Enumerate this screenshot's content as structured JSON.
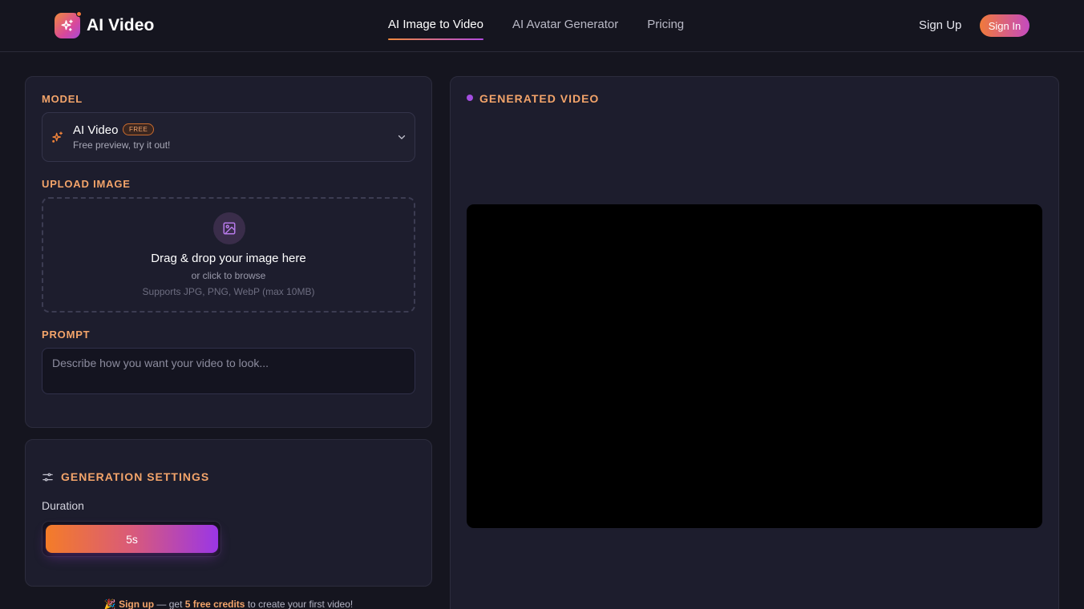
{
  "header": {
    "brand": "AI Video",
    "nav": [
      {
        "label": "AI Image to Video",
        "active": true
      },
      {
        "label": "AI Avatar Generator",
        "active": false
      },
      {
        "label": "Pricing",
        "active": false
      }
    ],
    "sign_up": "Sign Up",
    "sign_in": "Sign In"
  },
  "form": {
    "model_label": "MODEL",
    "model": {
      "name": "AI Video",
      "badge": "FREE",
      "description": "Free preview, try it out!",
      "icon": "sparkle-icon"
    },
    "upload_label": "UPLOAD IMAGE",
    "upload": {
      "title": "Drag & drop your image here",
      "subtitle": "or click to browse",
      "hint": "Supports JPG, PNG, WebP (max 10MB)",
      "icon": "image-icon"
    },
    "prompt_label": "PROMPT",
    "prompt_placeholder": "Describe how you want your video to look...",
    "prompt_value": ""
  },
  "settings": {
    "title": "GENERATION SETTINGS",
    "duration_label": "Duration",
    "duration_value": "5s"
  },
  "footer": {
    "emoji": "🎉",
    "link": "Sign up",
    "dash": " — get ",
    "credits": "5 free credits",
    "rest": " to create your first video!"
  },
  "output": {
    "title": "GENERATED VIDEO"
  },
  "colors": {
    "background": "#15151f",
    "panel": "#1d1d2d",
    "accent_orange": "#f3a46a",
    "accent_purple": "#a34ee0"
  }
}
